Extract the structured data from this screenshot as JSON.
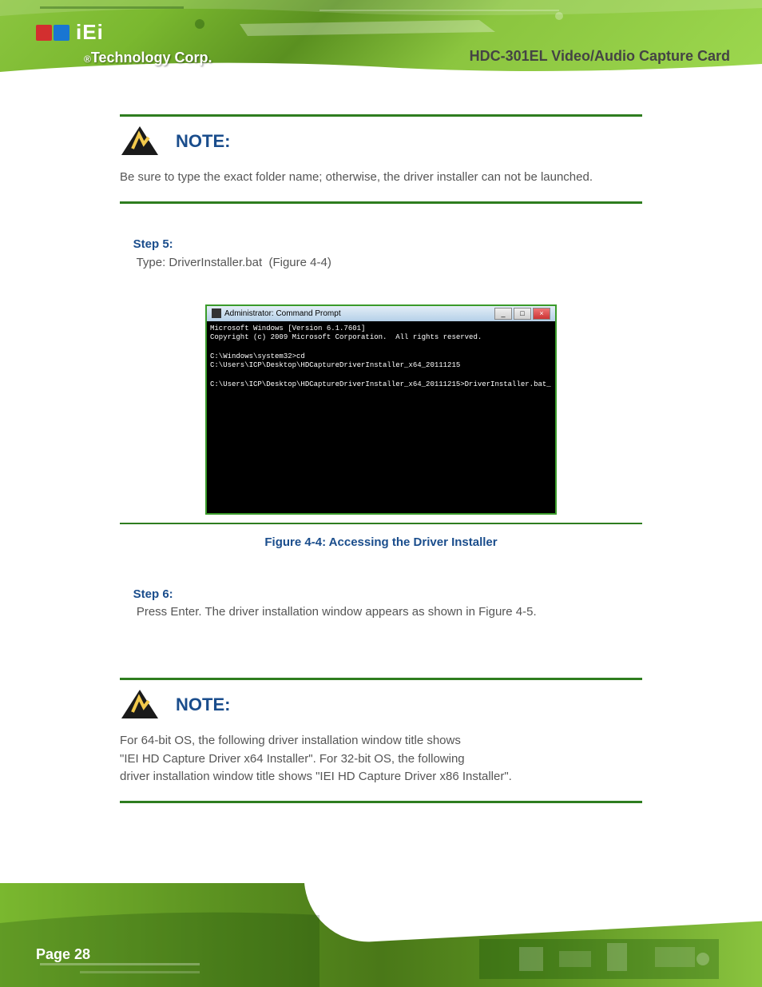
{
  "brand": {
    "logo_text": "iEi",
    "tech_prefix": "®",
    "tech_corp": "Technology Corp."
  },
  "product_header": "HDC-301EL Video/Audio Capture Card",
  "note1": {
    "label": "NOTE:",
    "text": "Be sure to type the exact folder name; otherwise, the driver installer can not be launched."
  },
  "step5_label": "Step 5:",
  "step5_text": "Type: DriverInstaller.bat  (Figure 4-4)",
  "cmd": {
    "title": "Administrator: Command Prompt",
    "line1": "Microsoft Windows [Version 6.1.7601]",
    "line2": "Copyright (c) 2009 Microsoft Corporation.  All rights reserved.",
    "line3": "C:\\Windows\\system32>cd C:\\Users\\ICP\\Desktop\\HDCaptureDriverInstaller_x64_20111215",
    "line4": "C:\\Users\\ICP\\Desktop\\HDCaptureDriverInstaller_x64_20111215>DriverInstaller.bat_",
    "minimize": "_",
    "maximize": "□",
    "close": "×"
  },
  "figure4_4": "Figure 4-4: Accessing the Driver Installer",
  "step6_label": "Step 6:",
  "step6_text": "Press Enter. The driver installation window appears as shown in Figure 4-5.",
  "note2": {
    "label": "NOTE:",
    "line1": "For 64-bit OS, the following driver installation window title shows",
    "quoted": "\"IEI HD Capture Driver x64 Installer\"",
    "line2_rest": ". For 32-bit OS, the following",
    "line3": "driver installation window title shows",
    "quoted2": "\"IEI HD Capture Driver x86 Installer\"",
    "period": "."
  },
  "page_number": "Page 28"
}
